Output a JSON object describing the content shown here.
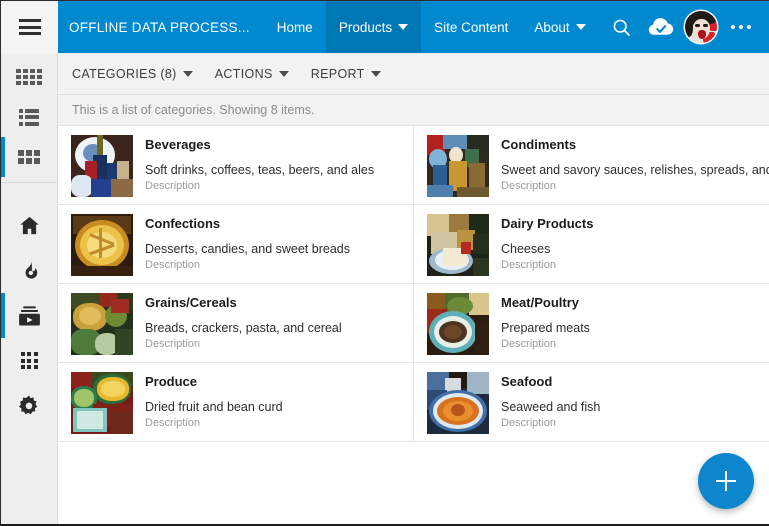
{
  "appbar": {
    "menu_icon": "hamburger-icon",
    "brand": "OFFLINE DATA PROCESS...",
    "nav": [
      {
        "label": "Home",
        "has_caret": false,
        "active": false
      },
      {
        "label": "Products",
        "has_caret": true,
        "active": true
      },
      {
        "label": "Site Content",
        "has_caret": false,
        "active": false
      },
      {
        "label": "About",
        "has_caret": true,
        "active": false
      }
    ],
    "actions": [
      {
        "name": "search-icon"
      },
      {
        "name": "cloud-check-icon"
      },
      {
        "name": "avatar"
      },
      {
        "name": "more-options-icon"
      }
    ],
    "accent_color": "#0089ce",
    "active_tab_color": "#0077b5"
  },
  "rail": {
    "view_modes": [
      {
        "name": "dense-grid-view-icon",
        "selected": false
      },
      {
        "name": "list-view-icon",
        "selected": false
      },
      {
        "name": "tile-view-icon",
        "selected": true
      }
    ],
    "nav": [
      {
        "name": "home-icon",
        "selected": false
      },
      {
        "name": "flame-icon",
        "selected": false
      },
      {
        "name": "media-library-icon",
        "selected": true
      },
      {
        "name": "apps-grid-icon",
        "selected": false
      },
      {
        "name": "settings-gear-icon",
        "selected": false
      }
    ],
    "selected_indicator_color": "#0089ce"
  },
  "commandbar": {
    "items": [
      {
        "label": "CATEGORIES (8)",
        "has_caret": true
      },
      {
        "label": "ACTIONS",
        "has_caret": true
      },
      {
        "label": "REPORT",
        "has_caret": true
      }
    ]
  },
  "infobar": {
    "text": "This is a list of categories. Showing 8 items."
  },
  "categories": [
    {
      "title": "Beverages",
      "description": "Soft drinks, coffees, teas, beers, and ales",
      "sub_label": "Description",
      "thumb_name": "beverages-thumbnail"
    },
    {
      "title": "Condiments",
      "description": "Sweet and savory sauces, relishes, spreads, and sea",
      "sub_label": "Description",
      "thumb_name": "condiments-thumbnail"
    },
    {
      "title": "Confections",
      "description": "Desserts, candies, and sweet breads",
      "sub_label": "Description",
      "thumb_name": "confections-thumbnail"
    },
    {
      "title": "Dairy Products",
      "description": "Cheeses",
      "sub_label": "Description",
      "thumb_name": "dairy-products-thumbnail"
    },
    {
      "title": "Grains/Cereals",
      "description": "Breads, crackers, pasta, and cereal",
      "sub_label": "Description",
      "thumb_name": "grains-cereals-thumbnail"
    },
    {
      "title": "Meat/Poultry",
      "description": "Prepared meats",
      "sub_label": "Description",
      "thumb_name": "meat-poultry-thumbnail"
    },
    {
      "title": "Produce",
      "description": "Dried fruit and bean curd",
      "sub_label": "Description",
      "thumb_name": "produce-thumbnail"
    },
    {
      "title": "Seafood",
      "description": "Seaweed and fish",
      "sub_label": "Description",
      "thumb_name": "seafood-thumbnail"
    }
  ],
  "fab": {
    "name": "add-category-button",
    "glyph": "+",
    "color": "#0e86cd"
  }
}
